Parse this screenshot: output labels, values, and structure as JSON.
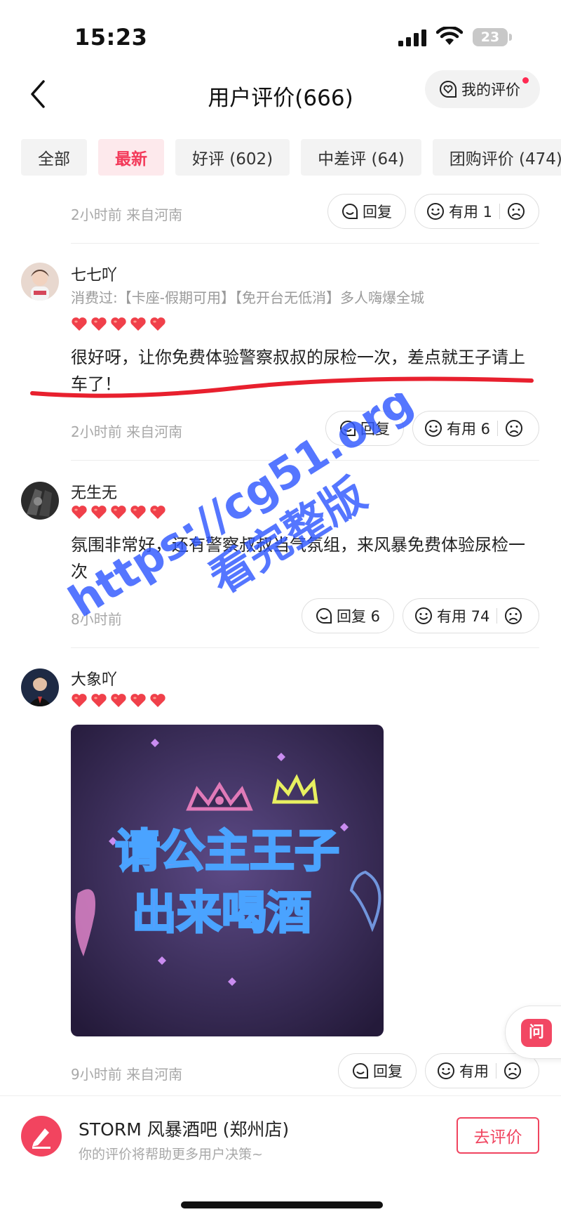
{
  "status_bar": {
    "time": "15:23",
    "battery": "23"
  },
  "nav": {
    "title": "用户评价(666)",
    "my_review": "我的评价"
  },
  "tabs": [
    {
      "label": "全部",
      "active": false
    },
    {
      "label": "最新",
      "active": true
    },
    {
      "label": "好评 (602)",
      "active": false
    },
    {
      "label": "中差评 (64)",
      "active": false
    },
    {
      "label": "团购评价 (474)",
      "active": false
    }
  ],
  "reviews": [
    {
      "time_location": "2小时前  来自河南",
      "reply_label": "回复",
      "useful_label": "有用 1"
    },
    {
      "name": "七七吖",
      "consumed": "消费过:【卡座-假期可用】【免开台无低消】多人嗨爆全城",
      "rating": 5,
      "text": "很好呀，让你免费体验警察叔叔的尿检一次，差点就王子请上车了！",
      "time_location": "2小时前  来自河南",
      "reply_label": "回复",
      "useful_label": "有用 6"
    },
    {
      "name": "无生无",
      "rating": 5,
      "text": "氛围非常好，还有警察叔叔当气氛组，来风暴免费体验尿检一次",
      "time_location": "8小时前",
      "reply_label": "回复 6",
      "useful_label": "有用 74"
    },
    {
      "name": "大象吖",
      "rating": 5,
      "photo_text_line1": "请公主王子",
      "photo_text_line2": "出来喝酒",
      "time_location": "9小时前  来自河南",
      "reply_label": "回复",
      "useful_label": "有用"
    }
  ],
  "watermark": {
    "line1": "https://cg51.org",
    "line2": "看完整版"
  },
  "ask_button": "问",
  "bottom_bar": {
    "shop_name": "STORM 风暴酒吧 (郑州店)",
    "subtitle": "你的评价将帮助更多用户决策~",
    "write_review": "去评价"
  },
  "colors": {
    "accent": "#f33a5a",
    "heart": "#f0404a",
    "watermark": "#2f58ff"
  }
}
